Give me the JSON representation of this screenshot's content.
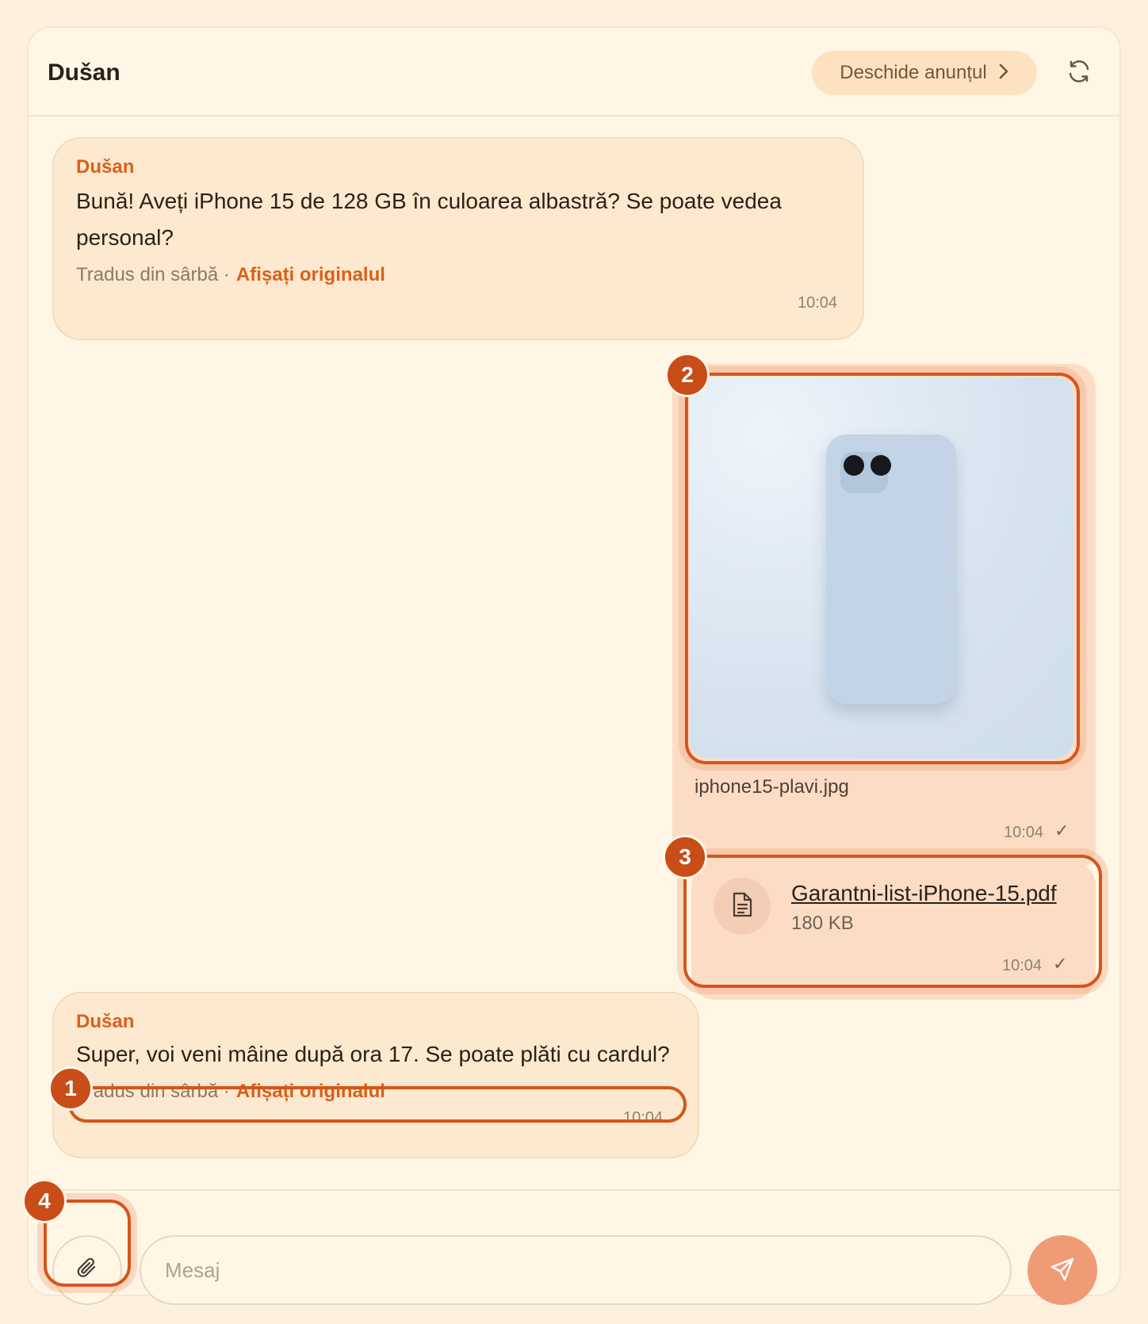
{
  "header": {
    "title": "Dušan",
    "open_listing_label": "Deschide anunțul",
    "icons": {
      "chevron": "chevron-right-icon",
      "refresh": "refresh-icon"
    }
  },
  "messages": [
    {
      "direction": "incoming",
      "sender": "Dušan",
      "text": "Bună! Aveți iPhone 15 de 128 GB în culoarea albastră? Se poate vedea personal?",
      "translation_note": "Tradus din sârbă ·",
      "show_original_label": "Afișați originalul",
      "time": "10:04"
    },
    {
      "direction": "outgoing",
      "type": "image",
      "filename": "iphone15-plavi.jpg",
      "time": "10:04",
      "status": "✓"
    },
    {
      "direction": "outgoing",
      "type": "file",
      "filename": "Garantni-list-iPhone-15.pdf",
      "size": "180 KB",
      "time": "10:04",
      "status": "✓"
    },
    {
      "direction": "incoming",
      "sender": "Dušan",
      "text": "Super, voi veni mâine după ora 17. Se poate plăti cu cardul?",
      "translation_note": "Tradus din sârbă ·",
      "show_original_label": "Afișați originalul",
      "time": "10:04"
    }
  ],
  "composer": {
    "placeholder": "Mesaj",
    "icons": {
      "attach": "paperclip-icon",
      "send": "send-icon"
    }
  },
  "annotations": [
    "1",
    "2",
    "3",
    "4"
  ],
  "colors": {
    "accent": "#d9601c",
    "annotation": "#c94d18",
    "send": "#ef9c76"
  }
}
